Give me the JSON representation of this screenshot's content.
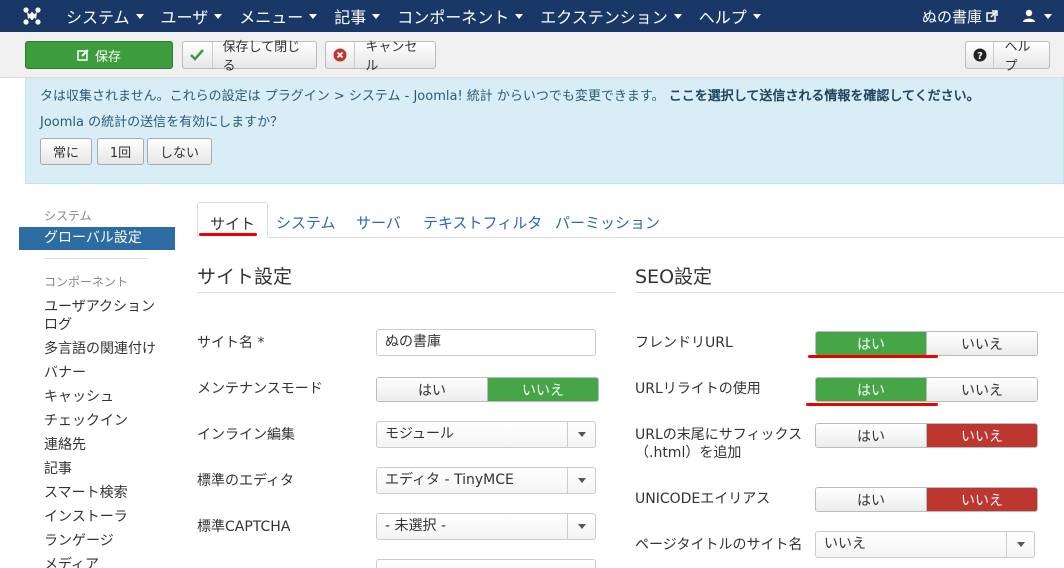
{
  "navbar": {
    "menu": [
      "システム",
      "ユーザ",
      "メニュー",
      "記事",
      "コンポーネント",
      "エクステンション",
      "ヘルプ"
    ],
    "site_name": "ぬの書庫"
  },
  "toolbar": {
    "save": "保存",
    "save_close": "保存して閉じる",
    "cancel": "キャンセル",
    "help": "ヘルプ"
  },
  "alert": {
    "line1_text": "タは収集されません。これらの設定は プラグイン > システム - Joomla! 統計 からいつでも変更できます。",
    "line1_bold": "ここを選択して送信される情報を確認してください。",
    "line2": "Joomla の統計の送信を有効にしますか？",
    "buttons": [
      "常に",
      "1回",
      "しない"
    ]
  },
  "sidebar": {
    "system_heading": "システム",
    "active": "グローバル設定",
    "components_heading": "コンポーネント",
    "items": [
      "ユーザアクション",
      "ログ",
      "多言語の関連付け",
      "バナー",
      "キャッシュ",
      "チェックイン",
      "連絡先",
      "記事",
      "スマート検索",
      "インストーラ",
      "ランゲージ",
      "メディア"
    ]
  },
  "tabs": [
    "サイト",
    "システム",
    "サーバ",
    "テキストフィルタ",
    "パーミッション"
  ],
  "site": {
    "title": "サイト設定",
    "site_name_label": "サイト名 *",
    "site_name_value": "ぬの書庫",
    "maintenance_label": "メンテナンスモード",
    "maintenance": {
      "yes": "はい",
      "no": "いいえ",
      "selected": "no"
    },
    "inline_label": "インライン編集",
    "inline_value": "モジュール",
    "editor_label": "標準のエディタ",
    "editor_value": "エディタ - TinyMCE",
    "captcha_label": "標準CAPTCHA",
    "captcha_value": "- 未選択 -"
  },
  "seo": {
    "title": "SEO設定",
    "friendly_label": "フレンドリURL",
    "friendly": {
      "yes": "はい",
      "no": "いいえ",
      "selected": "yes"
    },
    "rewrite_label": "URLリライトの使用",
    "rewrite": {
      "yes": "はい",
      "no": "いいえ",
      "selected": "yes"
    },
    "suffix_label_1": "URLの末尾にサフィックス",
    "suffix_label_2": "（.html）を追加",
    "suffix": {
      "yes": "はい",
      "no": "いいえ",
      "selected": "no"
    },
    "unicode_label": "UNICODEエイリアス",
    "unicode": {
      "yes": "はい",
      "no": "いいえ",
      "selected": "no"
    },
    "pagetitle_label": "ページタイトルのサイト名",
    "pagetitle_value": "いいえ"
  },
  "colors": {
    "navbar": "#1a3867",
    "save_green": "#3d9c3e",
    "toggle_green": "#46a546",
    "toggle_red": "#bd362f",
    "annotation_red": "#e00000"
  },
  "icons": {
    "logo": "joomla-logo-icon",
    "site_link": "external-link-icon",
    "user": "user-icon",
    "save": "edit-icon",
    "save_close": "check-icon",
    "cancel": "cancel-circle-icon",
    "help": "question-circle-icon",
    "select_arrow": "caret-down-icon"
  }
}
